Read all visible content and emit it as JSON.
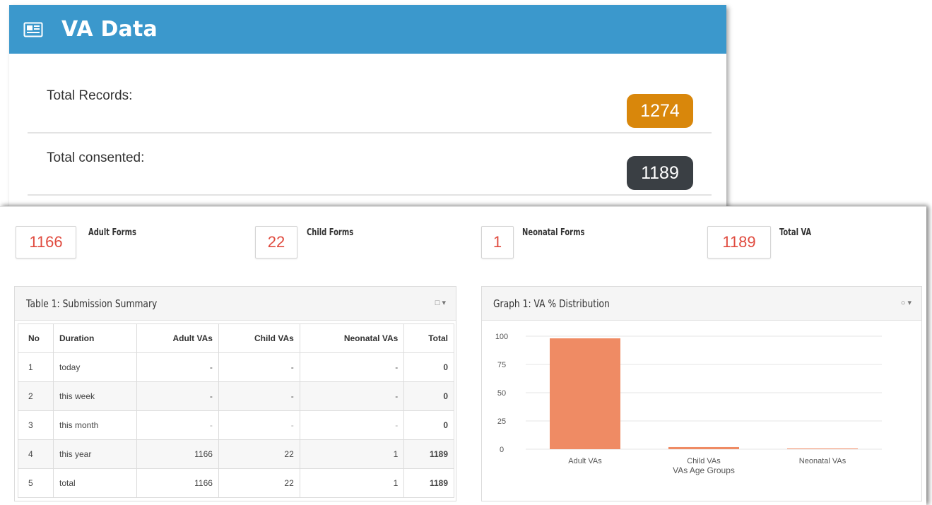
{
  "va_panel": {
    "title": "VA Data",
    "icon": "newspaper-icon",
    "rows": [
      {
        "label": "Total Records:",
        "value": "1274",
        "color": "#d9870b"
      },
      {
        "label": "Total consented:",
        "value": "1189",
        "color": "#3a3f44"
      }
    ]
  },
  "stats": [
    {
      "value": "1166",
      "label": "Adult Forms"
    },
    {
      "value": "22",
      "label": "Child Forms"
    },
    {
      "value": "1",
      "label": "Neonatal Forms"
    },
    {
      "value": "1189",
      "label": "Total VA"
    }
  ],
  "table": {
    "title": "Table 1: Submission Summary",
    "tool": "□ ▾",
    "columns": [
      "No",
      "Duration",
      "Adult VAs",
      "Child VAs",
      "Neonatal VAs",
      "Total"
    ],
    "rows": [
      [
        "1",
        "today",
        "-",
        "-",
        "-",
        "0"
      ],
      [
        "2",
        "this week",
        "-",
        "-",
        "-",
        "0"
      ],
      [
        "3",
        "this month",
        "-",
        "-",
        "-",
        "0"
      ],
      [
        "4",
        "this year",
        "1166",
        "22",
        "1",
        "1189"
      ],
      [
        "5",
        "total",
        "1166",
        "22",
        "1",
        "1189"
      ]
    ]
  },
  "graph": {
    "title": "Graph 1: VA % Distribution",
    "tool": "○ ▾"
  },
  "chart_data": {
    "type": "bar",
    "categories": [
      "Adult VAs",
      "Child VAs",
      "Neonatal VAs"
    ],
    "values": [
      98.1,
      1.9,
      0.1
    ],
    "xlabel": "VAs Age Groups",
    "ylabel": "",
    "ylim": [
      0,
      100
    ],
    "yticks": [
      "100",
      "75",
      "50",
      "25",
      "0"
    ],
    "grid": true,
    "bar_color": "#ef8b64"
  }
}
